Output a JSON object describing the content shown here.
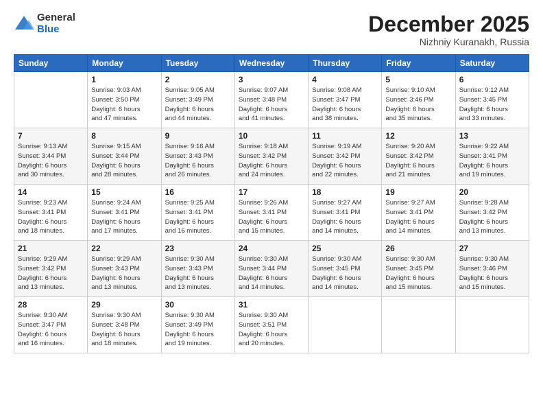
{
  "logo": {
    "general": "General",
    "blue": "Blue"
  },
  "header": {
    "month": "December 2025",
    "location": "Nizhniy Kuranakh, Russia"
  },
  "days_of_week": [
    "Sunday",
    "Monday",
    "Tuesday",
    "Wednesday",
    "Thursday",
    "Friday",
    "Saturday"
  ],
  "weeks": [
    [
      {
        "day": "",
        "info": ""
      },
      {
        "day": "1",
        "info": "Sunrise: 9:03 AM\nSunset: 3:50 PM\nDaylight: 6 hours\nand 47 minutes."
      },
      {
        "day": "2",
        "info": "Sunrise: 9:05 AM\nSunset: 3:49 PM\nDaylight: 6 hours\nand 44 minutes."
      },
      {
        "day": "3",
        "info": "Sunrise: 9:07 AM\nSunset: 3:48 PM\nDaylight: 6 hours\nand 41 minutes."
      },
      {
        "day": "4",
        "info": "Sunrise: 9:08 AM\nSunset: 3:47 PM\nDaylight: 6 hours\nand 38 minutes."
      },
      {
        "day": "5",
        "info": "Sunrise: 9:10 AM\nSunset: 3:46 PM\nDaylight: 6 hours\nand 35 minutes."
      },
      {
        "day": "6",
        "info": "Sunrise: 9:12 AM\nSunset: 3:45 PM\nDaylight: 6 hours\nand 33 minutes."
      }
    ],
    [
      {
        "day": "7",
        "info": "Sunrise: 9:13 AM\nSunset: 3:44 PM\nDaylight: 6 hours\nand 30 minutes."
      },
      {
        "day": "8",
        "info": "Sunrise: 9:15 AM\nSunset: 3:44 PM\nDaylight: 6 hours\nand 28 minutes."
      },
      {
        "day": "9",
        "info": "Sunrise: 9:16 AM\nSunset: 3:43 PM\nDaylight: 6 hours\nand 26 minutes."
      },
      {
        "day": "10",
        "info": "Sunrise: 9:18 AM\nSunset: 3:42 PM\nDaylight: 6 hours\nand 24 minutes."
      },
      {
        "day": "11",
        "info": "Sunrise: 9:19 AM\nSunset: 3:42 PM\nDaylight: 6 hours\nand 22 minutes."
      },
      {
        "day": "12",
        "info": "Sunrise: 9:20 AM\nSunset: 3:42 PM\nDaylight: 6 hours\nand 21 minutes."
      },
      {
        "day": "13",
        "info": "Sunrise: 9:22 AM\nSunset: 3:41 PM\nDaylight: 6 hours\nand 19 minutes."
      }
    ],
    [
      {
        "day": "14",
        "info": "Sunrise: 9:23 AM\nSunset: 3:41 PM\nDaylight: 6 hours\nand 18 minutes."
      },
      {
        "day": "15",
        "info": "Sunrise: 9:24 AM\nSunset: 3:41 PM\nDaylight: 6 hours\nand 17 minutes."
      },
      {
        "day": "16",
        "info": "Sunrise: 9:25 AM\nSunset: 3:41 PM\nDaylight: 6 hours\nand 16 minutes."
      },
      {
        "day": "17",
        "info": "Sunrise: 9:26 AM\nSunset: 3:41 PM\nDaylight: 6 hours\nand 15 minutes."
      },
      {
        "day": "18",
        "info": "Sunrise: 9:27 AM\nSunset: 3:41 PM\nDaylight: 6 hours\nand 14 minutes."
      },
      {
        "day": "19",
        "info": "Sunrise: 9:27 AM\nSunset: 3:41 PM\nDaylight: 6 hours\nand 14 minutes."
      },
      {
        "day": "20",
        "info": "Sunrise: 9:28 AM\nSunset: 3:42 PM\nDaylight: 6 hours\nand 13 minutes."
      }
    ],
    [
      {
        "day": "21",
        "info": "Sunrise: 9:29 AM\nSunset: 3:42 PM\nDaylight: 6 hours\nand 13 minutes."
      },
      {
        "day": "22",
        "info": "Sunrise: 9:29 AM\nSunset: 3:43 PM\nDaylight: 6 hours\nand 13 minutes."
      },
      {
        "day": "23",
        "info": "Sunrise: 9:30 AM\nSunset: 3:43 PM\nDaylight: 6 hours\nand 13 minutes."
      },
      {
        "day": "24",
        "info": "Sunrise: 9:30 AM\nSunset: 3:44 PM\nDaylight: 6 hours\nand 14 minutes."
      },
      {
        "day": "25",
        "info": "Sunrise: 9:30 AM\nSunset: 3:45 PM\nDaylight: 6 hours\nand 14 minutes."
      },
      {
        "day": "26",
        "info": "Sunrise: 9:30 AM\nSunset: 3:45 PM\nDaylight: 6 hours\nand 15 minutes."
      },
      {
        "day": "27",
        "info": "Sunrise: 9:30 AM\nSunset: 3:46 PM\nDaylight: 6 hours\nand 15 minutes."
      }
    ],
    [
      {
        "day": "28",
        "info": "Sunrise: 9:30 AM\nSunset: 3:47 PM\nDaylight: 6 hours\nand 16 minutes."
      },
      {
        "day": "29",
        "info": "Sunrise: 9:30 AM\nSunset: 3:48 PM\nDaylight: 6 hours\nand 18 minutes."
      },
      {
        "day": "30",
        "info": "Sunrise: 9:30 AM\nSunset: 3:49 PM\nDaylight: 6 hours\nand 19 minutes."
      },
      {
        "day": "31",
        "info": "Sunrise: 9:30 AM\nSunset: 3:51 PM\nDaylight: 6 hours\nand 20 minutes."
      },
      {
        "day": "",
        "info": ""
      },
      {
        "day": "",
        "info": ""
      },
      {
        "day": "",
        "info": ""
      }
    ]
  ]
}
